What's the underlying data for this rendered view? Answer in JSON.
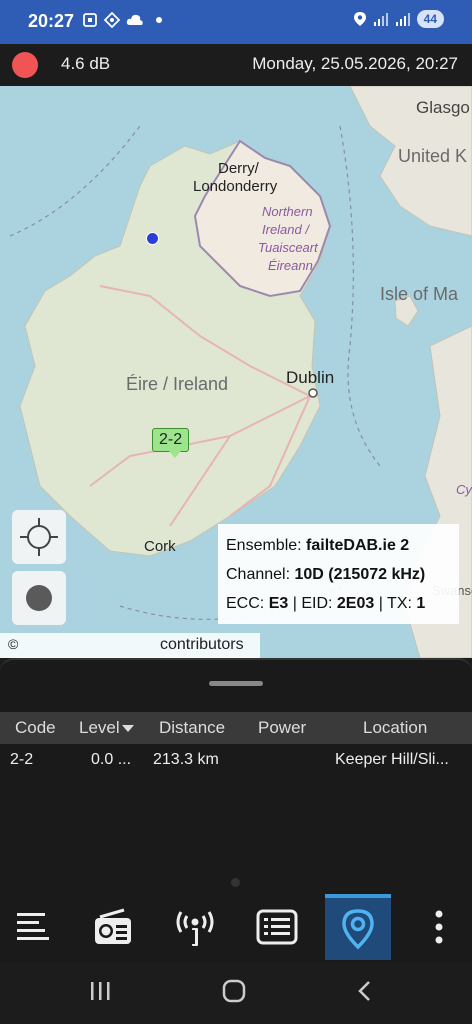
{
  "status_bar": {
    "time": "20:27",
    "battery": "44",
    "icons_left": [
      "screenshot-icon",
      "vpn-icon",
      "cloud-icon",
      "dot-icon"
    ],
    "icons_right": [
      "location-icon",
      "signal-icon",
      "signal-icon"
    ]
  },
  "header": {
    "level": "4.6 dB",
    "datetime": "Monday, 25.05.2026, 20:27",
    "record_color": "#f05454"
  },
  "map": {
    "labels": {
      "glasgow": "Glasgo",
      "united_kingdom": "United K",
      "derry": "Derry/",
      "londonderry": "Londonderry",
      "ni_1": "Northern",
      "ni_2": "Ireland /",
      "ni_3": "Tuaisceart",
      "ni_4": "Éireann",
      "isle_of_man": "Isle of Ma",
      "eire": "Éire / Ireland",
      "dublin": "Dublin",
      "cork": "Cork",
      "swansea": "Swansea",
      "cym": "Cy"
    },
    "marker_code": "2-2",
    "info": {
      "ensemble_label": "Ensemble:",
      "ensemble_value": "failteDAB.ie 2",
      "channel_label": "Channel:",
      "channel_value": "10D (215072 kHz)",
      "ecc_label": "ECC:",
      "ecc_value": "E3",
      "sep1": "|",
      "eid_label": "EID:",
      "eid_value": "2E03",
      "sep2": "|",
      "tx_label": "TX:",
      "tx_value": "1"
    },
    "attribution_symbol": "©",
    "attribution_text": "contributors"
  },
  "table": {
    "headers": {
      "code": "Code",
      "level": "Level",
      "distance": "Distance",
      "power": "Power",
      "location": "Location"
    },
    "rows": [
      {
        "code": "2-2",
        "level": "0.0 ...",
        "distance": "213.3 km",
        "power": "",
        "location": "Keeper Hill/Sli..."
      }
    ]
  },
  "bottom_nav": {
    "items": [
      "list-icon",
      "radio-icon",
      "antenna-icon",
      "log-icon",
      "map-pin-icon",
      "more-icon"
    ],
    "active": "map-pin-icon",
    "active_color": "#1f4a7a"
  },
  "system_nav": [
    "recents-icon",
    "home-icon",
    "back-icon"
  ]
}
